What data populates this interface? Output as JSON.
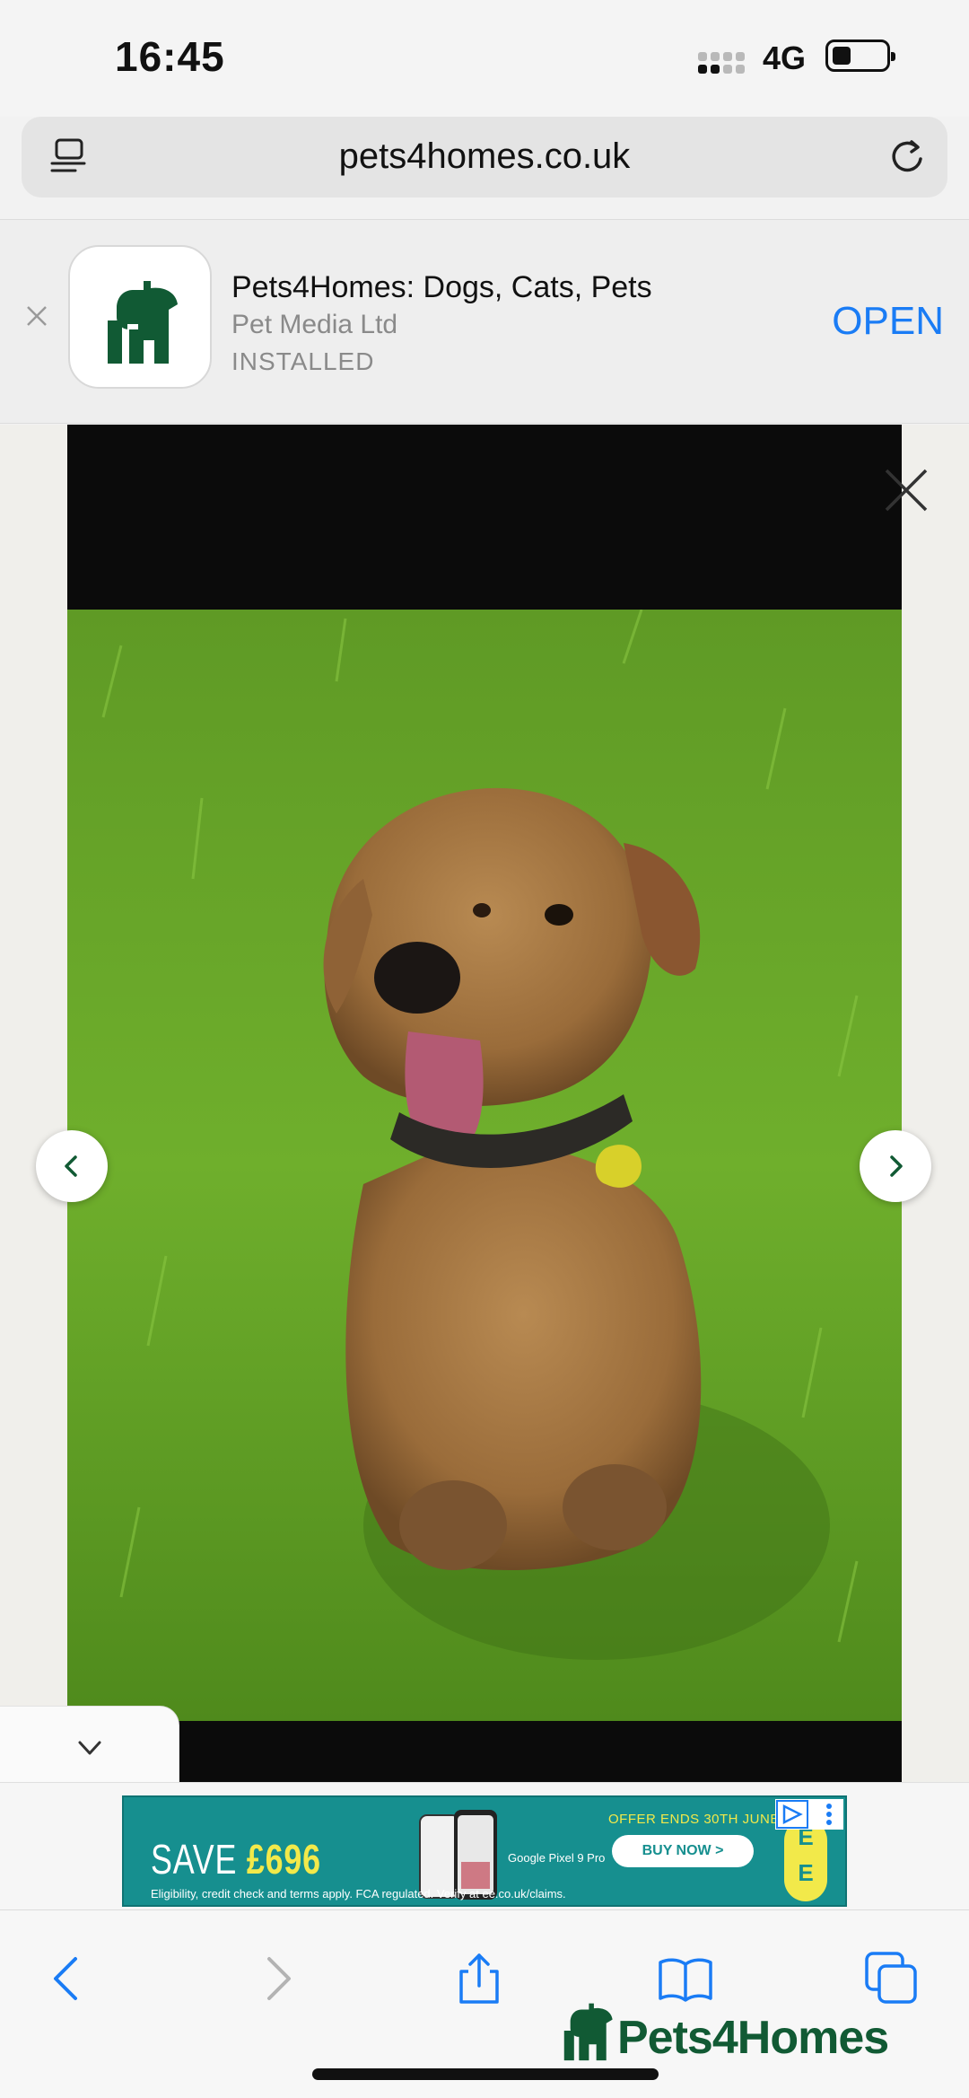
{
  "status_bar": {
    "time": "16:45",
    "network": "4G"
  },
  "url_bar": {
    "url": "pets4homes.co.uk"
  },
  "app_banner": {
    "app_name": "Pets4Homes: Dogs, Cats, Pets",
    "developer": "Pet Media Ltd",
    "state": "INSTALLED",
    "open_label": "OPEN"
  },
  "ad": {
    "headline": "SAVE ",
    "headline_amount": "£696",
    "offer": "OFFER ENDS 30TH JUNE",
    "cta": "BUY NOW >",
    "product": "Google Pixel 9 Pro",
    "legal": "Eligibility, credit check and terms apply. FCA regulated. Verify at ee.co.uk/claims.",
    "brand": "EE"
  },
  "footer_brand": {
    "name": "Pets4Homes"
  },
  "colors": {
    "accent_blue": "#1a7cf5",
    "brand_green": "#115a34",
    "ad_teal": "#168f8f",
    "ad_yellow": "#f2e94a"
  }
}
